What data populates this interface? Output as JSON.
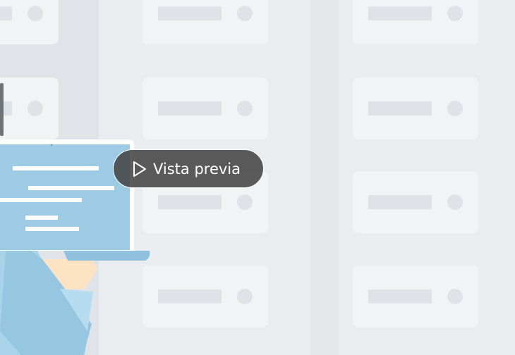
{
  "preview": {
    "label": "Vista previa",
    "icon": "play-icon"
  },
  "colors": {
    "background": "#e9edf0",
    "tile": "#f1f3f5",
    "tile_detail": "#dfe3e7",
    "button_bg": "#444444",
    "button_text": "#ffffff",
    "screen": "#9ccbe3"
  }
}
